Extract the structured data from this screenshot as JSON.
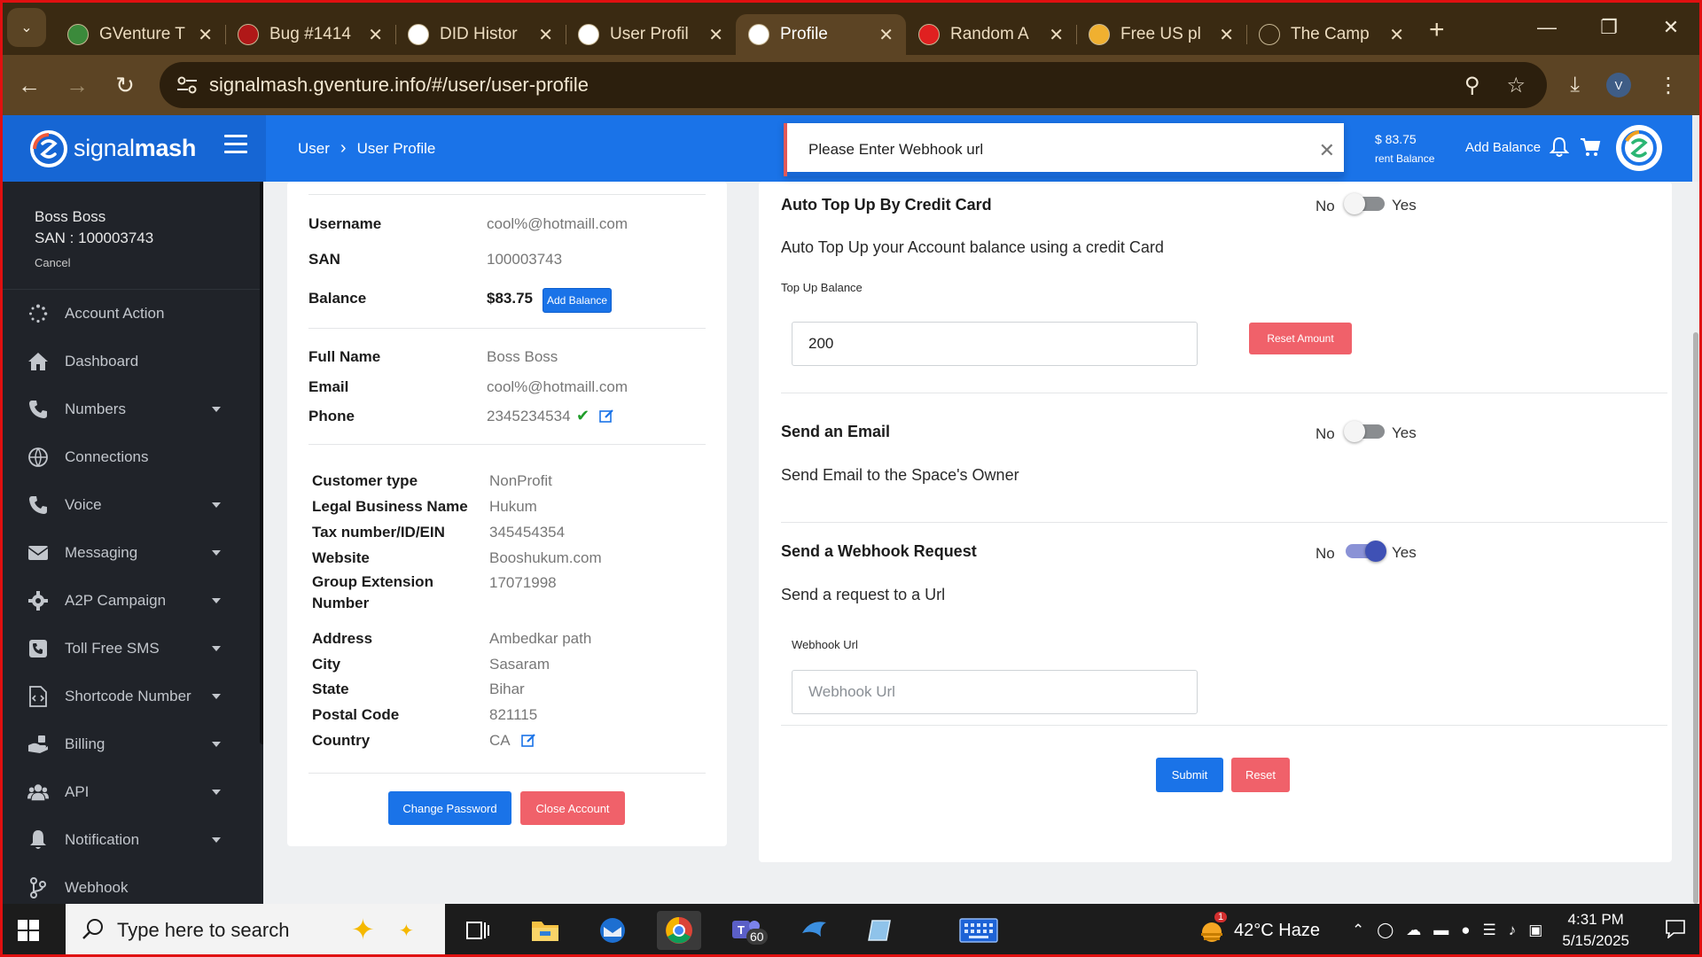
{
  "browser": {
    "tabs": [
      {
        "title": "GVenture T",
        "icon_color": "#3b8a3b",
        "icon": "gventure-icon"
      },
      {
        "title": "Bug #1414",
        "icon_color": "#b01818",
        "icon": "redmine-icon"
      },
      {
        "title": "DID Histor",
        "icon_color": "#ffffff",
        "icon": "signalmash-icon"
      },
      {
        "title": "User Profil",
        "icon_color": "#ffffff",
        "icon": "signalmash-icon"
      },
      {
        "title": "Profile",
        "icon_color": "#ffffff",
        "icon": "signalmash-icon",
        "active": true
      },
      {
        "title": "Random A",
        "icon_color": "#e02020",
        "icon": "random-icon"
      },
      {
        "title": "Free US pl",
        "icon_color": "#f0b030",
        "icon": "smiley-icon"
      },
      {
        "title": "The Camp",
        "icon_color": "#3a2a12",
        "icon": "page-icon"
      }
    ],
    "url": "signalmash.gventure.info/#/user/user-profile",
    "profile_initial": "V"
  },
  "header": {
    "brand_regular": "signal",
    "brand_bold": "mash",
    "breadcrumb": [
      "User",
      "User Profile"
    ],
    "balance_amount": "$ 83.75",
    "balance_caption": "rent Balance",
    "add_balance": "Add Balance",
    "toast": "Please Enter Webhook url"
  },
  "sidebar": {
    "user_name": "Boss Boss",
    "san": "SAN : 100003743",
    "cancel": "Cancel",
    "items": [
      {
        "label": "Account Action",
        "icon": "spinner-icon",
        "caret": false
      },
      {
        "label": "Dashboard",
        "icon": "home-icon",
        "caret": false
      },
      {
        "label": "Numbers",
        "icon": "phone-icon",
        "caret": true
      },
      {
        "label": "Connections",
        "icon": "globe-icon",
        "caret": false
      },
      {
        "label": "Voice",
        "icon": "phone-icon",
        "caret": true
      },
      {
        "label": "Messaging",
        "icon": "envelope-icon",
        "caret": true
      },
      {
        "label": "A2P Campaign",
        "icon": "gear-icon",
        "caret": true
      },
      {
        "label": "Toll Free SMS",
        "icon": "phone-square-icon",
        "caret": true
      },
      {
        "label": "Shortcode Number",
        "icon": "file-code-icon",
        "caret": true
      },
      {
        "label": "Billing",
        "icon": "hand-money-icon",
        "caret": true
      },
      {
        "label": "API",
        "icon": "users-icon",
        "caret": true
      },
      {
        "label": "Notification",
        "icon": "bell-icon",
        "caret": true
      },
      {
        "label": "Webhook",
        "icon": "branch-icon",
        "caret": false
      }
    ]
  },
  "profile": {
    "username_label": "Username",
    "username": "cool%@hotmaill.com",
    "san_label": "SAN",
    "san": "100003743",
    "balance_label": "Balance",
    "balance": "$83.75",
    "add_balance": "Add Balance",
    "fullname_label": "Full Name",
    "fullname": "Boss Boss",
    "email_label": "Email",
    "email": "cool%@hotmaill.com",
    "phone_label": "Phone",
    "phone": "2345234534",
    "business": [
      {
        "label": "Customer type",
        "value": "NonProfit"
      },
      {
        "label": "Legal Business Name",
        "value": "Hukum"
      },
      {
        "label": "Tax number/ID/EIN",
        "value": "345454354"
      },
      {
        "label": "Website",
        "value": "Booshukum.com"
      },
      {
        "label": "Group Extension Number",
        "value": "17071998"
      }
    ],
    "address": [
      {
        "label": "Address",
        "value": "Ambedkar path"
      },
      {
        "label": "City",
        "value": "Sasaram"
      },
      {
        "label": "State",
        "value": "Bihar"
      },
      {
        "label": "Postal Code",
        "value": "821115"
      },
      {
        "label": "Country",
        "value": "CA"
      }
    ],
    "change_password": "Change Password",
    "close_account": "Close Account"
  },
  "settings": {
    "toggle_no": "No",
    "toggle_yes": "Yes",
    "auto_topup": {
      "title": "Auto Top Up By Credit Card",
      "desc": "Auto Top Up your Account balance using a credit Card",
      "field_label": "Top Up Balance",
      "value": "200",
      "reset": "Reset Amount",
      "on": false
    },
    "email": {
      "title": "Send an Email",
      "desc": "Send Email to the Space's Owner",
      "on": false
    },
    "webhook": {
      "title": "Send a Webhook Request",
      "desc": "Send a request to a Url",
      "field_label": "Webhook Url",
      "placeholder": "Webhook Url",
      "on": true
    },
    "submit": "Submit",
    "reset": "Reset"
  },
  "taskbar": {
    "search_placeholder": "Type here to search",
    "teams_badge": "60",
    "weather": "42°C  Haze",
    "weather_badge": "1",
    "time": "4:31 PM",
    "date": "5/15/2025"
  },
  "colors": {
    "primary": "#1a73e8",
    "danger": "#f0616a",
    "sidebar": "#202329",
    "browser_chrome": "#3a2a12"
  }
}
